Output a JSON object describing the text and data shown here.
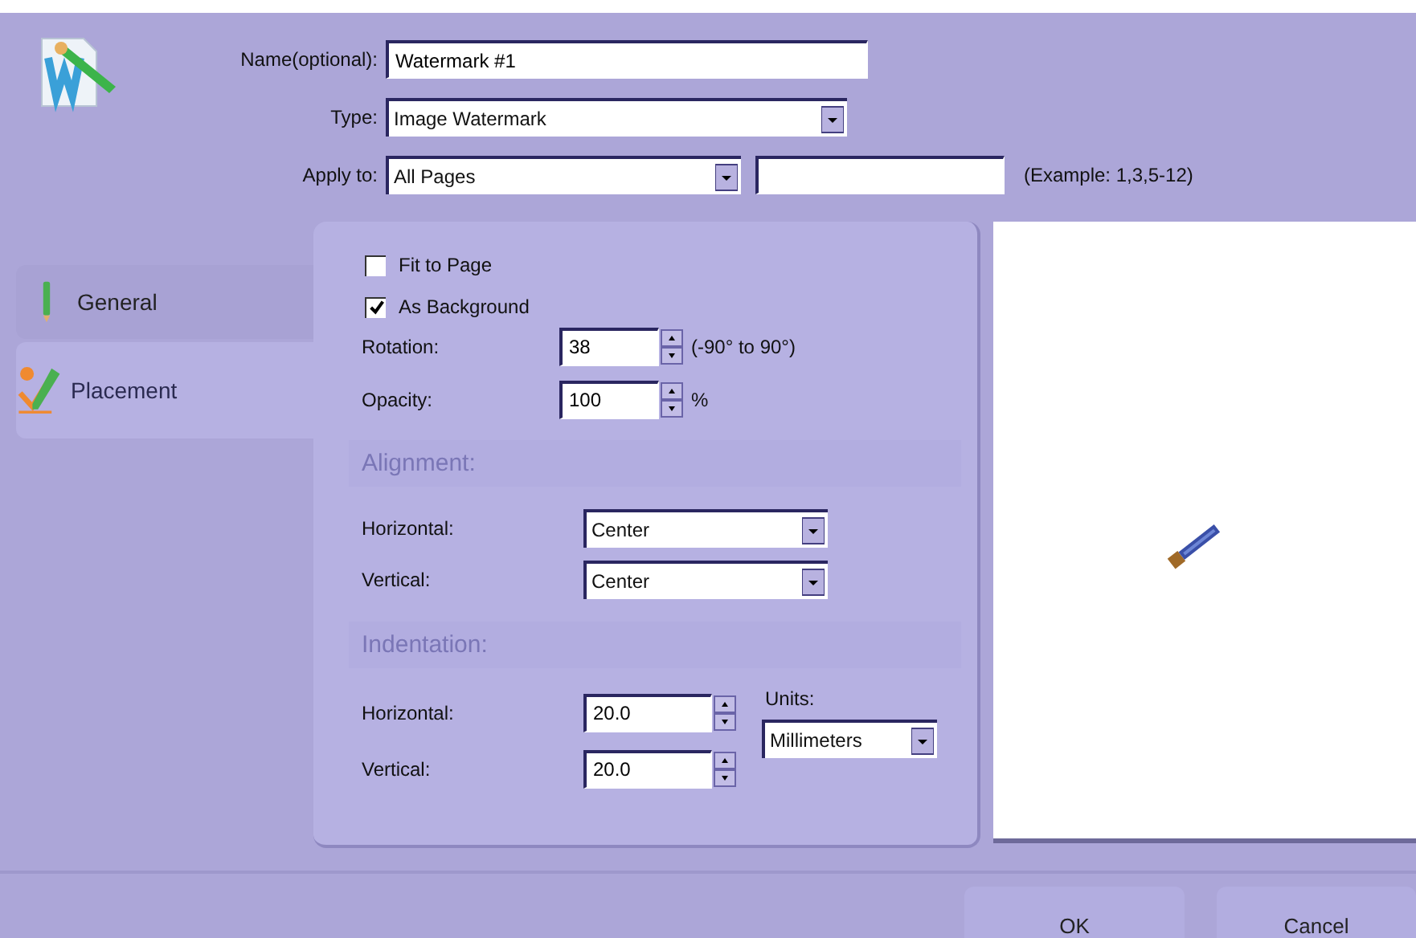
{
  "header": {
    "name": {
      "label": "Name(optional):",
      "value": "Watermark #1"
    },
    "type": {
      "label": "Type:",
      "value": "Image Watermark"
    },
    "apply_to": {
      "label": "Apply to:",
      "value": "All Pages",
      "hint": "(Example: 1,3,5-12)"
    }
  },
  "tabs": [
    {
      "label": "General",
      "kind": "pencil",
      "selected": false
    },
    {
      "label": "Placement",
      "kind": "placement",
      "selected": true
    }
  ],
  "placement": {
    "checkboxes": [
      {
        "label": "Fit to Page",
        "checked": false
      },
      {
        "label": "As Background",
        "checked": true
      }
    ],
    "spinners": [
      {
        "label": "Rotation:",
        "value": "38",
        "suffix": "(-90° to 90°)"
      },
      {
        "label": "Opacity:",
        "value": "100",
        "suffix": "%"
      }
    ],
    "alignment": {
      "title": "Alignment:",
      "rows": [
        {
          "label": "Horizontal:",
          "value": "Center"
        },
        {
          "label": "Vertical:",
          "value": "Center"
        }
      ]
    },
    "indentation": {
      "title": "Indentation:",
      "rows": [
        {
          "label": "Horizontal:",
          "value": "20.0"
        },
        {
          "label": "Vertical:",
          "value": "20.0"
        }
      ],
      "units_label": "Units:",
      "units_value": "Millimeters"
    }
  },
  "buttons": [
    "OK",
    "Cancel"
  ]
}
